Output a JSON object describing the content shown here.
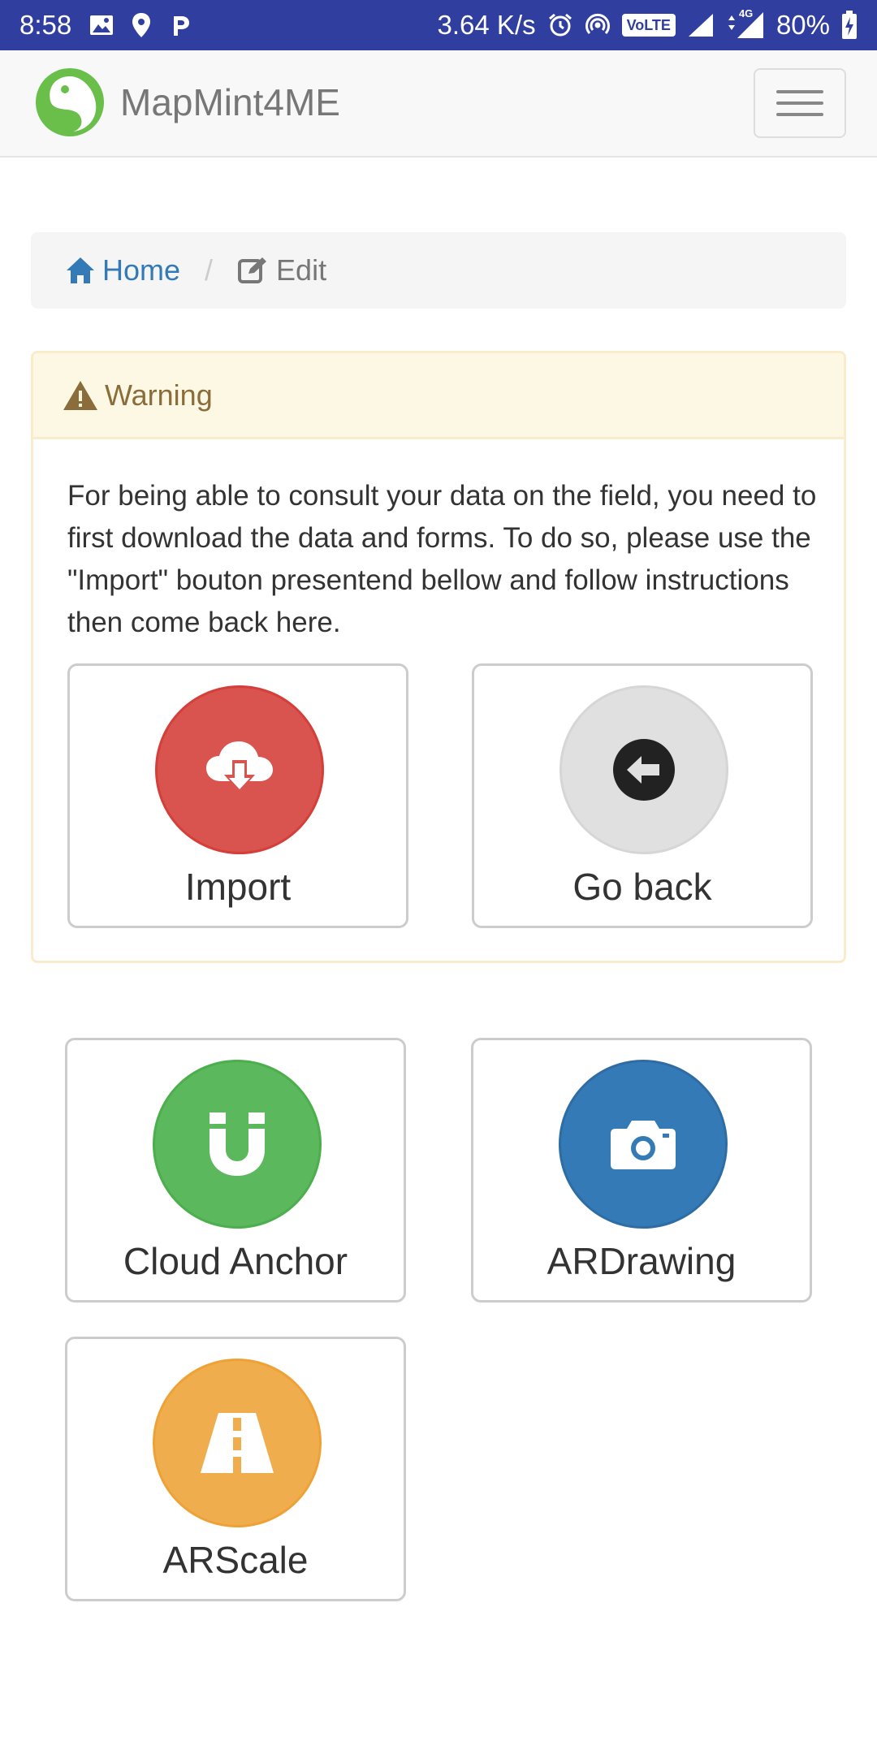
{
  "status_bar": {
    "time": "8:58",
    "network_speed": "3.64 K/s",
    "volte": "VoLTE",
    "network_type": "4G",
    "battery": "80%"
  },
  "navbar": {
    "brand": "MapMint4ME",
    "brand_color": "#6abf4b"
  },
  "breadcrumb": {
    "home": "Home",
    "separator": "/",
    "current": "Edit"
  },
  "warning": {
    "title": "Warning",
    "message": "For being able to consult your data on the field, you need to first download the data and forms. To do so, please use the \"Import\" bouton presentend bellow and follow instructions then come back here.",
    "buttons": [
      {
        "label": "Import",
        "icon": "cloud-download-icon",
        "color": "#d9534f"
      },
      {
        "label": "Go back",
        "icon": "arrow-circle-left-icon",
        "color": "#e0e0e0"
      }
    ]
  },
  "tools": [
    {
      "label": "Cloud Anchor",
      "icon": "magnet-icon",
      "color": "#5cb85c"
    },
    {
      "label": "ARDrawing",
      "icon": "camera-icon",
      "color": "#337ab7"
    },
    {
      "label": "ARScale",
      "icon": "road-icon",
      "color": "#f0ad4e"
    }
  ]
}
